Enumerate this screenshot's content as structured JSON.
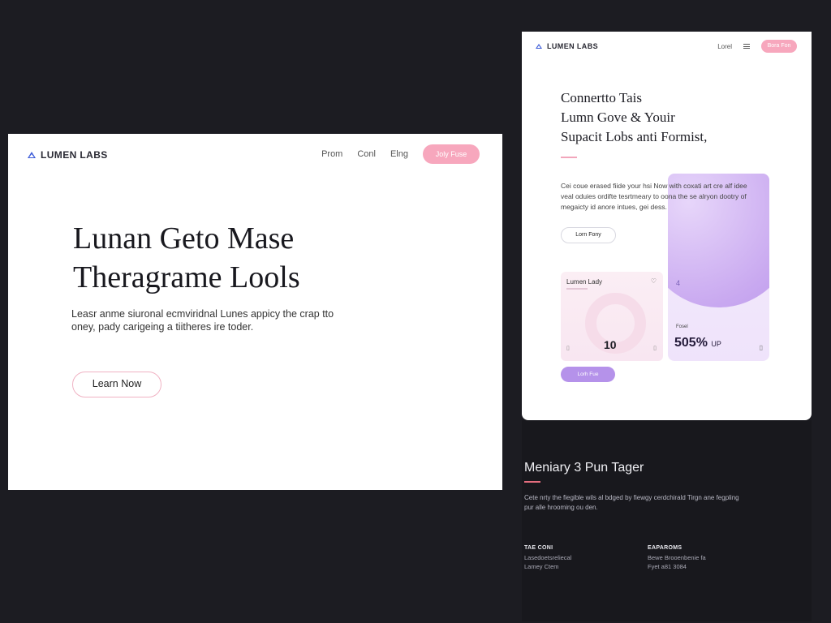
{
  "desktop": {
    "brand": "LUMEN LABS",
    "nav": [
      "Prom",
      "Conl",
      "Elng"
    ],
    "cta": "Joly Fuse",
    "headline": [
      "Lunan Geto Mase",
      "Theragrame Lools"
    ],
    "body": "Leasr anme siuronal ecmviridnal Lunes appicy the crap tto oney, pady carigeing a tiitheres ire toder.",
    "button": "Learn Now"
  },
  "mobile": {
    "brand": "LUMEN LABS",
    "nav_link": "Lorel",
    "cta": "Bora Fon",
    "headline": [
      "Connertto Tais",
      "Lumn Gove & Youir",
      "Supacit Lobs anti Formist,"
    ],
    "body": "Cei coue erased fiide your hsi Now with coxati art cre alf idee veal oduies ordifte tesrtmeary to oona the se alryon dootry of megaicty id anore intues, gei dess.",
    "outline_button": "Lorn Fony",
    "pink_card": {
      "title": "Lumen Lady",
      "heart": "♡",
      "value": "10",
      "icon_left": "▯",
      "icon_right": "▯"
    },
    "lav_card": {
      "mark": "4",
      "label": "Fosel",
      "value": "505%",
      "unit": "UP",
      "icon": "▯"
    },
    "purple_button": "Lorh Fue"
  },
  "footer": {
    "title": "Meniary 3 Pun Tager",
    "body": "Cete nrty the fiegible wils al bdged by fiewgy cerdchirald Tirgn ane fegpling pur alle hrooming ou den.",
    "columns": [
      {
        "head": "TAE CONI",
        "lines": [
          "Lasedoetsreliecal",
          "Lamey Ctem"
        ]
      },
      {
        "head": "EAPAROMS",
        "lines": [
          "Bewe Brooenbenie fa",
          "Fyet a81 3084"
        ]
      }
    ]
  },
  "colors": {
    "background": "#1c1c22",
    "accent_pink": "#f7a7bd",
    "accent_purple": "#b592ea",
    "brand_blue": "#3c5bd8"
  }
}
